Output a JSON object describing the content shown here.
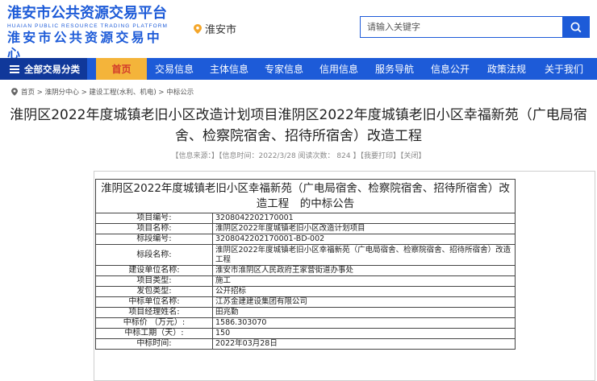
{
  "header": {
    "logo_cn": "淮安市公共资源交易平台",
    "logo_en": "HUAIAN PUBLIC RESOURCE TRADING PLATFORM",
    "logo_cn2": "淮安市公共资源交易中心",
    "city": "淮安市",
    "search_placeholder": "请输入关键字",
    "brand_color": "#1d5bd8"
  },
  "nav": {
    "all_label": "全部交易分类",
    "items": [
      "首页",
      "交易信息",
      "主体信息",
      "专家信息",
      "信用信息",
      "服务导航",
      "信息公开",
      "政策法规",
      "关于我们"
    ],
    "active_index": 0,
    "active_bg": "#f4b43a",
    "active_color": "#d23a2a"
  },
  "breadcrumb": "首页 > 淮阴分中心 > 建设工程(水利、机电) > 中标公示",
  "article": {
    "title": "淮阴区2022年度城镇老旧小区改造计划项目淮阴区2022年度城镇老旧小区幸福新苑（广电局宿舍、检察院宿舍、招待所宿舍）改造工程",
    "meta": "【信息来源：】【信息时间：2022/3/28 阅读次数： 824 】【我要打印】【关闭】"
  },
  "table": {
    "heading": "淮阴区2022年度城镇老旧小区幸福新苑（广电局宿舍、检察院宿舍、招待所宿舍）改造工程　的中标公告",
    "rows": [
      {
        "label": "项目编号:",
        "value": "3208042202170001"
      },
      {
        "label": "项目名称:",
        "value": "淮阴区2022年度城镇老旧小区改造计划项目"
      },
      {
        "label": "标段编号:",
        "value": "3208042202170001-BD-002"
      },
      {
        "label": "标段名称:",
        "value": "淮阴区2022年度城镇老旧小区幸福新苑（广电局宿舍、检察院宿舍、招待所宿舍）改造工程"
      },
      {
        "label": "建设单位名称:",
        "value": "淮安市淮阴区人民政府王家营街道办事处"
      },
      {
        "label": "项目类型:",
        "value": "施工"
      },
      {
        "label": "发包类型:",
        "value": "公开招标"
      },
      {
        "label": "中标单位名称:",
        "value": "江苏金建建设集团有限公司"
      },
      {
        "label": "项目经理姓名:",
        "value": "田兆勤"
      },
      {
        "label": "中标价 （万元）:",
        "value": "1586.303070"
      },
      {
        "label": "中标工期（天）:",
        "value": "150"
      },
      {
        "label": "中标时间:",
        "value": "2022年03月28日"
      }
    ]
  }
}
